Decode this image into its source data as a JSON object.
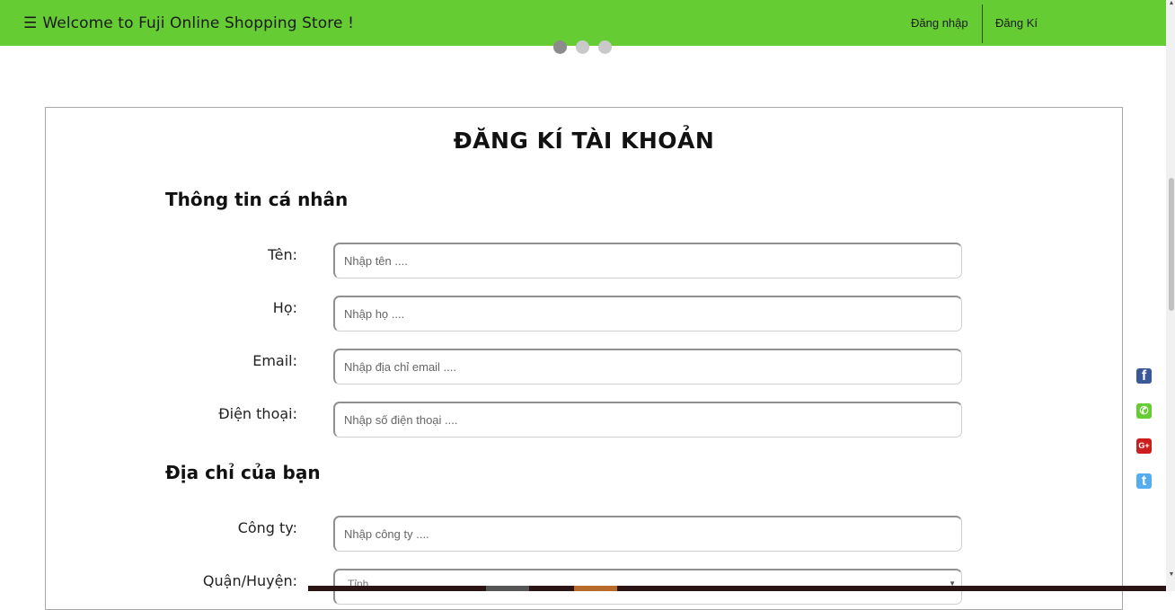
{
  "header": {
    "menu_glyph": "☰",
    "brand": "Welcome to Fuji Online Shopping Store !",
    "login": "Đăng nhập",
    "register": "Đăng Kí",
    "background_color": "#66cc33"
  },
  "carousel": {
    "total_slides": 3,
    "active_slide": 1
  },
  "form": {
    "title": "ĐĂNG KÍ TÀI KHOẢN",
    "personal_section": "Thông tin cá nhân",
    "first_name": {
      "label": "Tên:",
      "placeholder": "Nhập tên ...."
    },
    "last_name": {
      "label": "Họ:",
      "placeholder": "Nhập họ ...."
    },
    "email": {
      "label": "Email:",
      "placeholder": "Nhập địa chỉ email ...."
    },
    "phone": {
      "label": "Điện thoại:",
      "placeholder": "Nhập số điện thoại ...."
    },
    "address_section": "Địa chỉ của bạn",
    "company": {
      "label": "Công ty:",
      "placeholder": "Nhập công ty ...."
    },
    "district": {
      "label": "Quận/Huyện:",
      "selected": "Tỉnh"
    }
  },
  "social": [
    {
      "name": "facebook",
      "icon": "facebook-icon",
      "glyph": "f",
      "color": "#3b5998"
    },
    {
      "name": "phone",
      "icon": "phone-icon",
      "glyph": "✆",
      "color": "#66cc33"
    },
    {
      "name": "google-plus",
      "icon": "google-plus-icon",
      "glyph": "G+",
      "color": "#cc1e1e"
    },
    {
      "name": "twitter",
      "icon": "twitter-icon",
      "glyph": "t",
      "color": "#55acee"
    }
  ]
}
